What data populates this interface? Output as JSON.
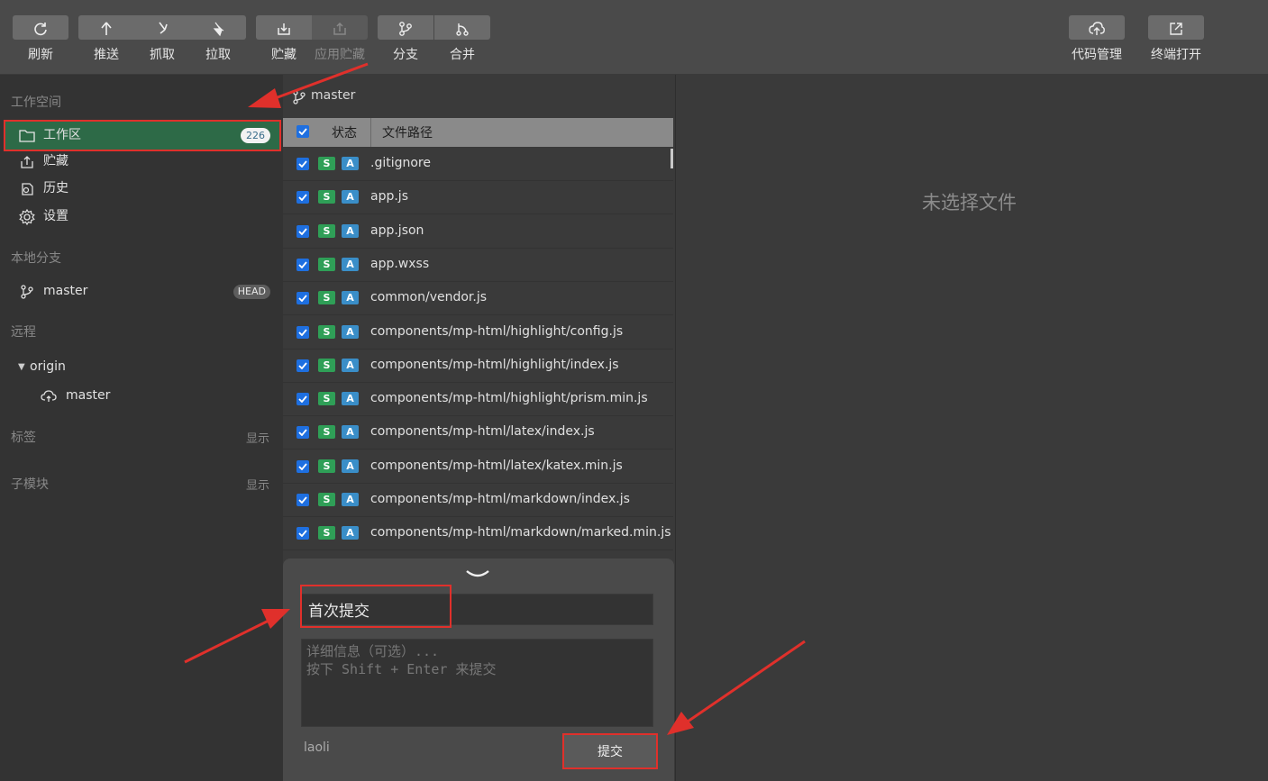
{
  "toolbar": {
    "refresh": "刷新",
    "push": "推送",
    "fetch": "抓取",
    "pull": "拉取",
    "stash": "贮藏",
    "apply_stash": "应用贮藏",
    "branch": "分支",
    "merge": "合并",
    "code_manage": "代码管理",
    "terminal_open": "终端打开"
  },
  "sidebar": {
    "workspace_title": "工作空间",
    "workspace_items": [
      {
        "label": "工作区",
        "count": "226"
      },
      {
        "label": "贮藏"
      },
      {
        "label": "历史"
      },
      {
        "label": "设置"
      }
    ],
    "local_branch_title": "本地分支",
    "local_branch": {
      "name": "master",
      "badge": "HEAD"
    },
    "remote_title": "远程",
    "remote": {
      "name": "origin",
      "branch": "master"
    },
    "tags_title": "标签",
    "tags_action": "显示",
    "submodules_title": "子模块",
    "submodules_action": "显示"
  },
  "filelist": {
    "branch": "master",
    "col_status": "状态",
    "col_path": "文件路径",
    "files": [
      ".gitignore",
      "app.js",
      "app.json",
      "app.wxss",
      "common/vendor.js",
      "components/mp-html/highlight/config.js",
      "components/mp-html/highlight/index.js",
      "components/mp-html/highlight/prism.min.js",
      "components/mp-html/latex/index.js",
      "components/mp-html/latex/katex.min.js",
      "components/mp-html/markdown/index.js",
      "components/mp-html/markdown/marked.min.js"
    ],
    "tag_s": "S",
    "tag_a": "A"
  },
  "commit": {
    "summary": "首次提交",
    "description_placeholder": "详细信息（可选）...\n按下 Shift + Enter 来提交",
    "author": "laoli",
    "submit": "提交"
  },
  "diff": {
    "empty": "未选择文件"
  },
  "colors": {
    "accent_green": "#2d6a47",
    "annotation_red": "#e0302b",
    "checkbox_blue": "#1e6fe0",
    "tag_s_green": "#2f9f57",
    "tag_a_blue": "#3a8ec8"
  }
}
